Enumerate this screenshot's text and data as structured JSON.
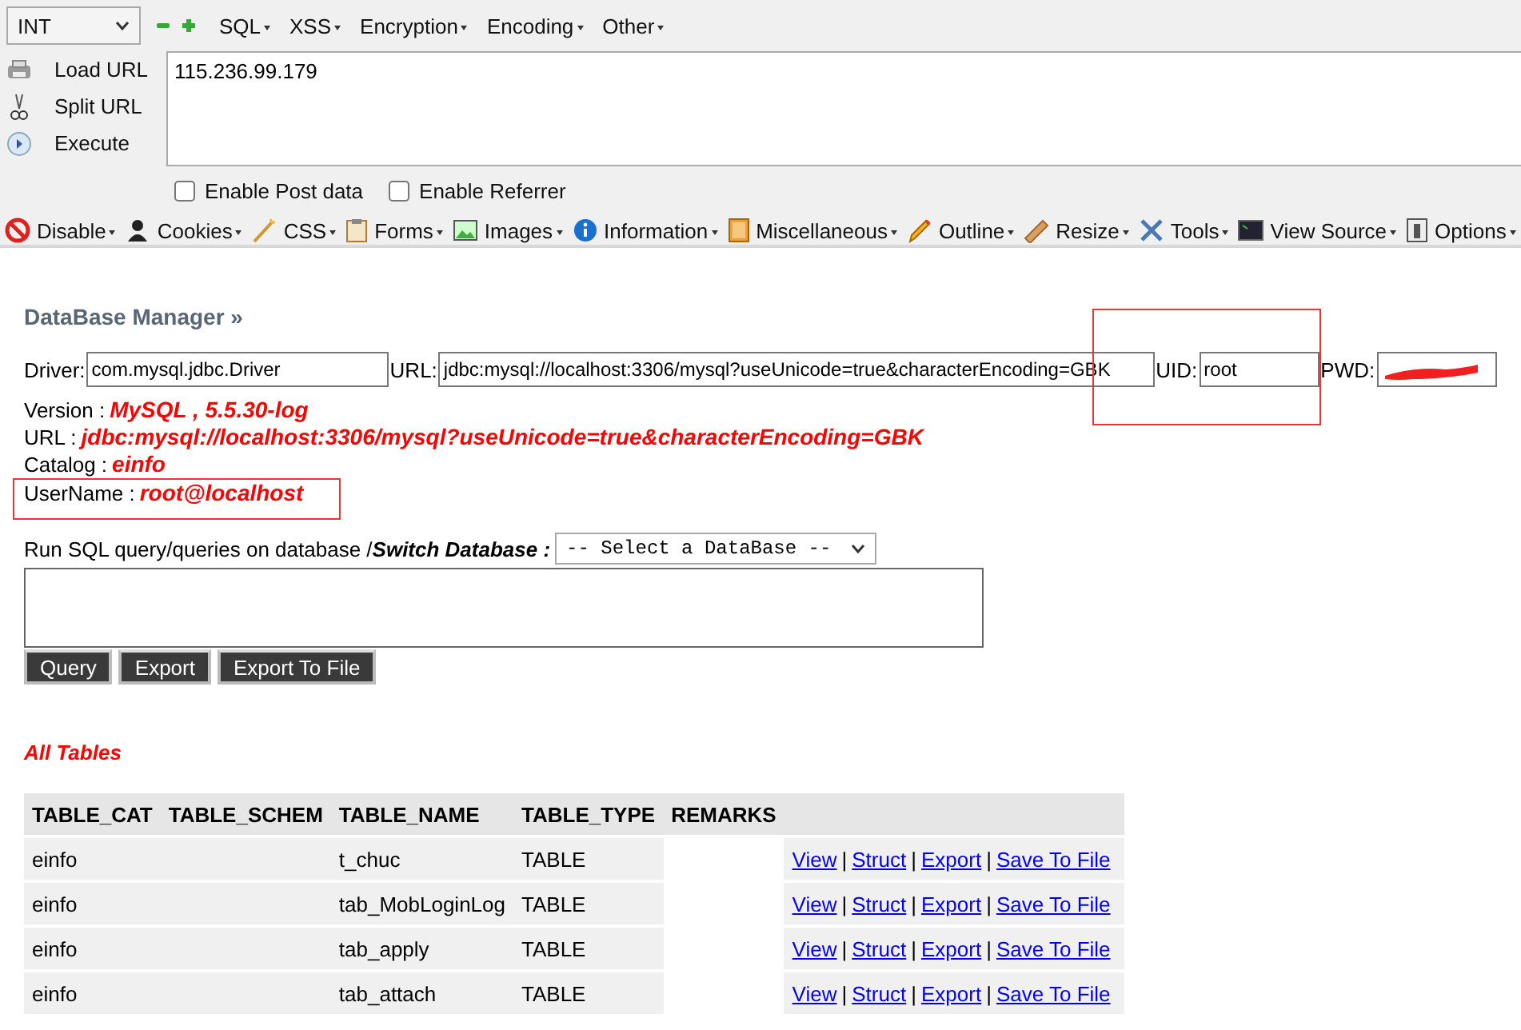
{
  "hackbar": {
    "type_select": "INT",
    "menus": [
      "SQL",
      "XSS",
      "Encryption",
      "Encoding",
      "Other"
    ],
    "actions": [
      {
        "label": "Load URL",
        "kind": "printer"
      },
      {
        "label": "Split URL",
        "kind": "scissors"
      },
      {
        "label": "Execute",
        "kind": "play"
      }
    ],
    "url": "115.236.99.179",
    "options": [
      {
        "label": "Enable Post data",
        "checked": false
      },
      {
        "label": "Enable Referrer",
        "checked": false
      }
    ]
  },
  "dev_toolbar": [
    {
      "label": "Disable",
      "kind": "forbidden"
    },
    {
      "label": "Cookies",
      "kind": "person"
    },
    {
      "label": "CSS",
      "kind": "wand"
    },
    {
      "label": "Forms",
      "kind": "clipboard"
    },
    {
      "label": "Images",
      "kind": "picture"
    },
    {
      "label": "Information",
      "kind": "info"
    },
    {
      "label": "Miscellaneous",
      "kind": "book"
    },
    {
      "label": "Outline",
      "kind": "pencil"
    },
    {
      "label": "Resize",
      "kind": "ruler"
    },
    {
      "label": "Tools",
      "kind": "tools"
    },
    {
      "label": "View Source",
      "kind": "terminal"
    },
    {
      "label": "Options",
      "kind": "switch"
    }
  ],
  "page": {
    "title": "DataBase Manager »",
    "connection": {
      "driver_label": "Driver:",
      "driver": "com.mysql.jdbc.Driver",
      "url_label": "URL:",
      "url": "jdbc:mysql://localhost:3306/mysql?useUnicode=true&characterEncoding=GBK",
      "uid_label": "UID:",
      "uid": "root",
      "uid_highlighted": true,
      "pwd_label": "PWD:",
      "pwd_redacted": true
    },
    "info": [
      {
        "label": "Version :",
        "value": "MySQL , 5.5.30-log",
        "highlighted": false
      },
      {
        "label": "URL :",
        "value": "jdbc:mysql://localhost:3306/mysql?useUnicode=true&characterEncoding=GBK",
        "highlighted": false
      },
      {
        "label": "Catalog :",
        "value": "einfo",
        "highlighted": false
      },
      {
        "label": "UserName :",
        "value": "root@localhost",
        "highlighted": true
      }
    ],
    "query": {
      "label": "Run SQL query/queries on database / ",
      "switch_label": "Switch Database :",
      "database_select": "-- Select a DataBase --",
      "buttons": [
        "Query",
        "Export",
        "Export To File"
      ]
    },
    "tables_title": "All Tables",
    "table": {
      "columns": [
        "TABLE_CAT",
        "TABLE_SCHEM",
        "TABLE_NAME",
        "TABLE_TYPE",
        "REMARKS"
      ],
      "separator": "|",
      "rows": [
        {
          "cells": [
            "einfo",
            "",
            "t_chuc",
            "TABLE",
            ""
          ],
          "links": [
            "View",
            "Struct",
            "Export",
            "Save To File"
          ]
        },
        {
          "cells": [
            "einfo",
            "",
            "tab_MobLoginLog",
            "TABLE",
            ""
          ],
          "links": [
            "View",
            "Struct",
            "Export",
            "Save To File"
          ]
        },
        {
          "cells": [
            "einfo",
            "",
            "tab_apply",
            "TABLE",
            ""
          ],
          "links": [
            "View",
            "Struct",
            "Export",
            "Save To File"
          ]
        },
        {
          "cells": [
            "einfo",
            "",
            "tab_attach",
            "TABLE",
            ""
          ],
          "links": [
            "View",
            "Struct",
            "Export",
            "Save To File"
          ]
        }
      ]
    }
  }
}
